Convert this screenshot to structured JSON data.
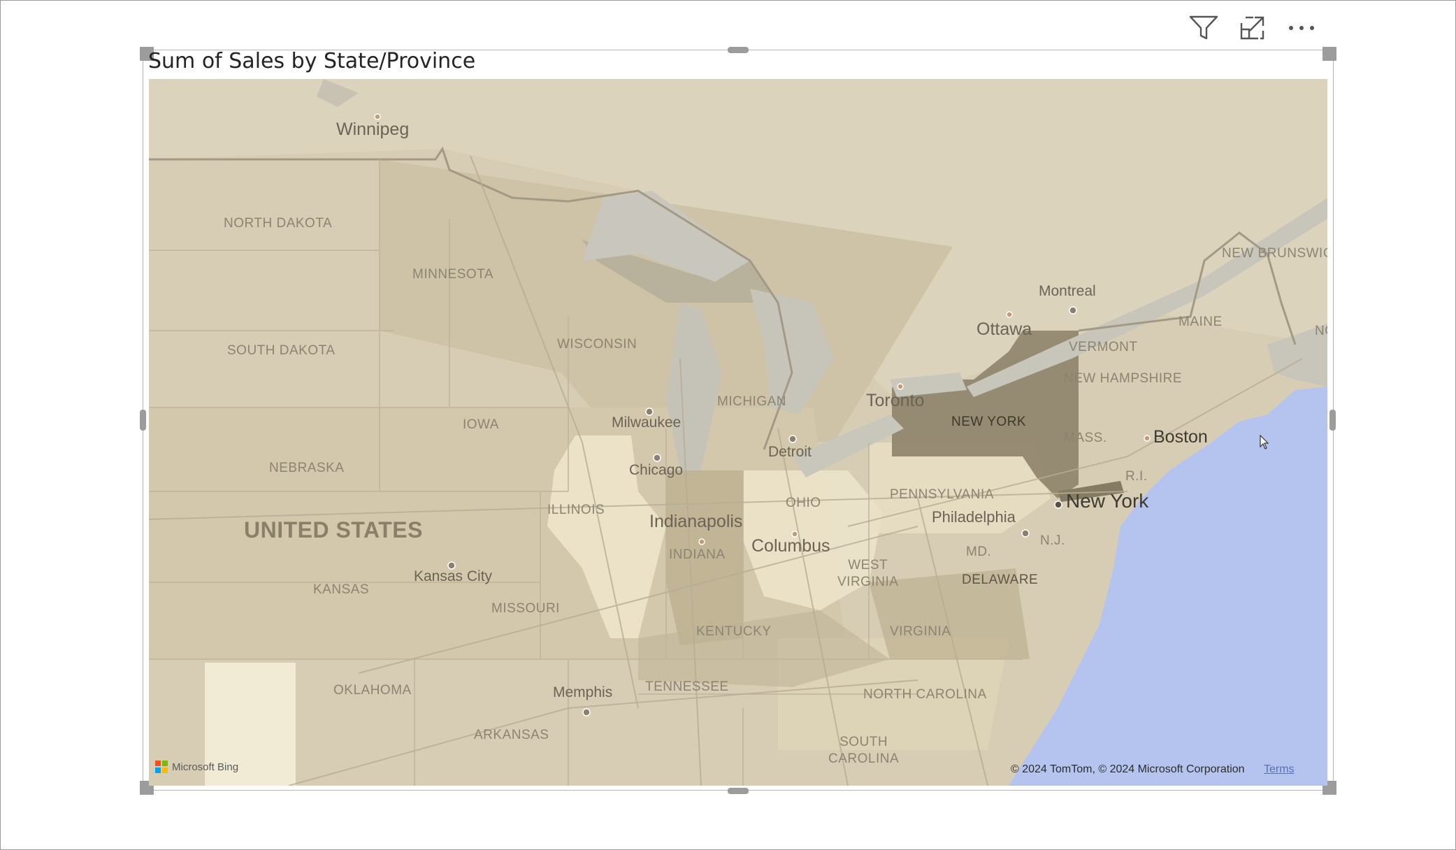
{
  "visual": {
    "title": "Sum of Sales by State/Province"
  },
  "header_icons": [
    "filter-icon",
    "focus-mode-icon",
    "more-options-icon"
  ],
  "map": {
    "country_labels": [
      {
        "id": "united-states",
        "text": "UNITED STATES"
      }
    ],
    "state_labels": [
      {
        "id": "north-dakota",
        "text": "NORTH DAKOTA"
      },
      {
        "id": "minnesota",
        "text": "MINNESOTA"
      },
      {
        "id": "south-dakota",
        "text": "SOUTH DAKOTA"
      },
      {
        "id": "wisconsin",
        "text": "WISCONSIN"
      },
      {
        "id": "iowa",
        "text": "IOWA"
      },
      {
        "id": "nebraska",
        "text": "NEBRASKA"
      },
      {
        "id": "michigan",
        "text": "MICHIGAN"
      },
      {
        "id": "illinois",
        "text": "ILLINOIS"
      },
      {
        "id": "ohio",
        "text": "OHIO"
      },
      {
        "id": "indiana",
        "text": "INDIANA"
      },
      {
        "id": "kansas",
        "text": "KANSAS"
      },
      {
        "id": "missouri",
        "text": "MISSOURI"
      },
      {
        "id": "kentucky",
        "text": "KENTUCKY"
      },
      {
        "id": "west-virginia",
        "text": "WEST\nVIRGINIA"
      },
      {
        "id": "virginia",
        "text": "VIRGINIA"
      },
      {
        "id": "oklahoma",
        "text": "OKLAHOMA"
      },
      {
        "id": "tennessee",
        "text": "TENNESSEE"
      },
      {
        "id": "arkansas",
        "text": "ARKANSAS"
      },
      {
        "id": "north-carolina",
        "text": "NORTH CAROLINA"
      },
      {
        "id": "south-carolina",
        "text": "SOUTH\nCAROLINA"
      },
      {
        "id": "pennsylvania",
        "text": "PENNSYLVANIA"
      },
      {
        "id": "new-york",
        "text": "NEW YORK"
      },
      {
        "id": "vermont",
        "text": "VERMONT"
      },
      {
        "id": "new-hampshire",
        "text": "NEW HAMPSHIRE"
      },
      {
        "id": "maine",
        "text": "MAINE"
      },
      {
        "id": "mass",
        "text": "MASS."
      },
      {
        "id": "ri",
        "text": "R.I."
      },
      {
        "id": "nj",
        "text": "N.J."
      },
      {
        "id": "md",
        "text": "MD."
      },
      {
        "id": "delaware",
        "text": "DELAWARE"
      },
      {
        "id": "new-brunswick",
        "text": "NEW BRUNSWIC"
      },
      {
        "id": "nova-scotia",
        "text": "NO"
      }
    ],
    "city_labels": [
      {
        "id": "winnipeg",
        "text": "Winnipeg"
      },
      {
        "id": "milwaukee",
        "text": "Milwaukee"
      },
      {
        "id": "chicago",
        "text": "Chicago"
      },
      {
        "id": "detroit",
        "text": "Detroit"
      },
      {
        "id": "toronto",
        "text": "Toronto"
      },
      {
        "id": "ottawa",
        "text": "Ottawa"
      },
      {
        "id": "montreal",
        "text": "Montreal"
      },
      {
        "id": "boston",
        "text": "Boston"
      },
      {
        "id": "new-york-city",
        "text": "New York"
      },
      {
        "id": "philadelphia",
        "text": "Philadelphia"
      },
      {
        "id": "indianapolis",
        "text": "Indianapolis"
      },
      {
        "id": "columbus",
        "text": "Columbus"
      },
      {
        "id": "kansas-city",
        "text": "Kansas City"
      },
      {
        "id": "memphis",
        "text": "Memphis"
      }
    ],
    "colors": {
      "land": "#d6cdb4",
      "water": "#b4c4ee",
      "highlight_strong": "#8e836a",
      "highlight_light": "#efe7cf"
    }
  },
  "attribution": {
    "bing": "Microsoft Bing",
    "copyright": "© 2024 TomTom, © 2024 Microsoft Corporation",
    "terms": "Terms"
  }
}
